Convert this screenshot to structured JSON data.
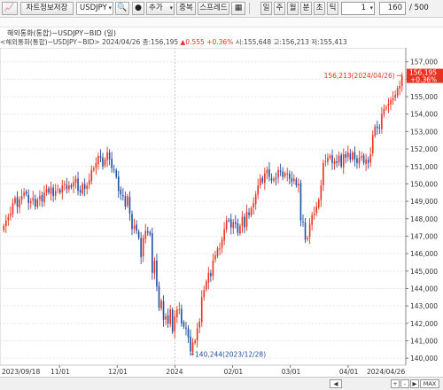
{
  "toolbar": {
    "save_chart_label": "차트정보저장",
    "symbol": "USDJPY",
    "add_label": "추가",
    "overlay_label": "중복",
    "spread_label": "스프레드",
    "period_day": "일",
    "period_week": "주",
    "period_month": "월",
    "period_minute": "분",
    "period_second": "초",
    "period_tick": "틱",
    "interval_value": "1",
    "count_value": "160",
    "total_label": "/ 500"
  },
  "chart_title": "해외통화(통합)−USDJPY−BID (일)",
  "info": {
    "label": "<해외통화(통합)−USDJPY−BID> 2024/04/26 종:156,195",
    "change": "▲0.555  +0.36%",
    "ohlc": "시:155,648 고:156,213 저:155,413"
  },
  "price_tag": {
    "price": "156,195",
    "change": "+0.36%"
  },
  "annotations": {
    "high": "156,213(2024/04/26)",
    "low": "140,244(2023/12/28)"
  },
  "bottom_buttons": [
    "◀",
    "+",
    "-",
    "▶",
    "MAX"
  ],
  "colors": {
    "up": "#e8321f",
    "down": "#1f4fa3",
    "grid": "#e6e6e6"
  },
  "chart_data": {
    "type": "candlestick",
    "x_ticks": [
      "2023/09/18",
      "11/01",
      "12/01",
      "2024",
      "02/01",
      "03/01",
      "04/01",
      "2024/04/26"
    ],
    "y_ticks": [
      140000,
      141000,
      142000,
      143000,
      144000,
      145000,
      146000,
      147000,
      148000,
      149000,
      150000,
      151000,
      152000,
      153000,
      154000,
      155000,
      156000,
      157000
    ],
    "ylim": [
      139600,
      157800
    ],
    "last": {
      "date": "2024/04/26",
      "close": 156195,
      "open": 155648,
      "high": 156213,
      "low": 155413
    },
    "high_marker": {
      "date": "2024/04/26",
      "value": 156213
    },
    "low_marker": {
      "date": "2023/12/28",
      "value": 140244
    },
    "closes": [
      147600,
      147900,
      148100,
      148300,
      148900,
      149200,
      148700,
      149100,
      149300,
      149500,
      149400,
      148900,
      149000,
      149200,
      148700,
      149100,
      149300,
      149000,
      149500,
      149700,
      149500,
      149800,
      149300,
      149600,
      149700,
      149500,
      149900,
      150000,
      149700,
      149900,
      149800,
      150100,
      150300,
      149600,
      149500,
      150000,
      149700,
      149900,
      150200,
      150800,
      150900,
      151200,
      151600,
      151500,
      151000,
      151400,
      151800,
      151400,
      150900,
      150800,
      150400,
      149600,
      149400,
      149300,
      148700,
      149300,
      148300,
      147400,
      147600,
      147300,
      146900,
      145800,
      146900,
      147300,
      147200,
      147100,
      144900,
      145600,
      144100,
      142900,
      143300,
      142200,
      142400,
      142000,
      142800,
      141500,
      142400,
      142800,
      142800,
      142000,
      141800,
      141700,
      141200,
      140400,
      140900,
      141000,
      141700,
      142100,
      143500,
      143900,
      144400,
      144900,
      144700,
      145600,
      145900,
      146300,
      146300,
      146800,
      147400,
      147900,
      147900,
      147500,
      147800,
      147700,
      147200,
      147600,
      148100,
      147500,
      148400,
      148200,
      148600,
      148900,
      149400,
      149900,
      150300,
      150100,
      150600,
      150800,
      150400,
      150200,
      150300,
      150300,
      150800,
      150700,
      150400,
      150600,
      150600,
      150300,
      150100,
      150300,
      149900,
      150000,
      147900,
      147800,
      146800,
      146900,
      147700,
      148200,
      148300,
      148700,
      149100,
      149900,
      151200,
      151300,
      151500,
      151600,
      151200,
      151300,
      151200,
      151600,
      151000,
      151700,
      151500,
      151800,
      151400,
      151800,
      151400,
      151200,
      151500,
      151600,
      151200,
      151400,
      151200,
      151700,
      152800,
      153300,
      153200,
      153200,
      154000,
      154300,
      154400,
      154600,
      154800,
      154900,
      155100,
      155500,
      155600,
      156200
    ]
  }
}
